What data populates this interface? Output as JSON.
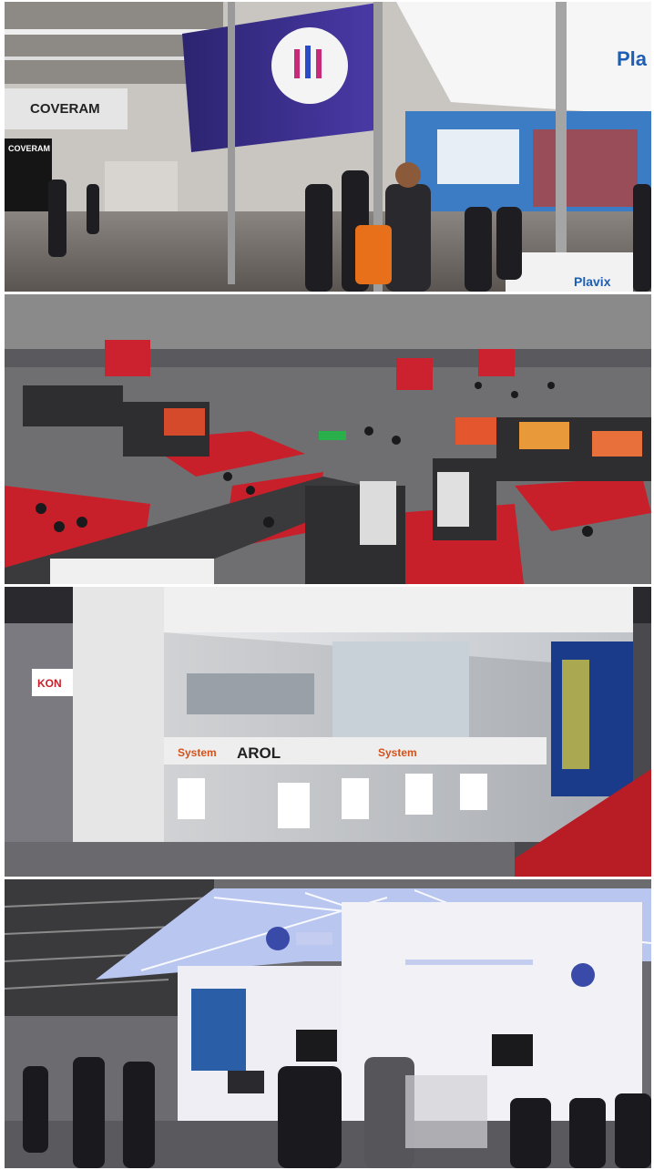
{
  "panels": [
    {
      "id": "booth-coveram-plavix",
      "signs": {
        "coveram_wall": "COVERAM",
        "coveram_banner": "COVERAM",
        "plavix_top": "Pla",
        "plavix_counter": "Plavix"
      }
    },
    {
      "id": "exhibition-hall-overview",
      "signs": {}
    },
    {
      "id": "glass-booth-arol",
      "signs": {
        "arol": "AROL",
        "system_left": "System",
        "system_right": "System",
        "kon": "KON"
      }
    },
    {
      "id": "white-booth-led-ceiling",
      "signs": {}
    }
  ],
  "colors": {
    "banner_purple": "#3a2f8a",
    "hall_red_carpet": "#c8202a",
    "booth_white": "#f2f2f4",
    "ceiling_blue": "#b8c6f0",
    "plavix_blue": "#1d5fb4",
    "bag_orange": "#e8701a"
  }
}
